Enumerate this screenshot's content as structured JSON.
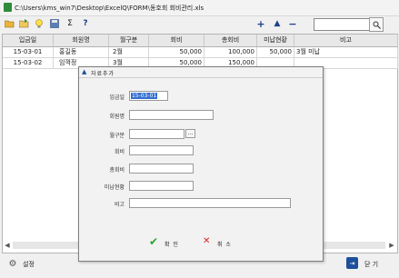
{
  "window": {
    "title": "C:\\Users\\kms_win7\\Desktop\\ExcelQ\\FORM\\동호회 회비관리.xls"
  },
  "toolbar": {
    "add_symbol": "+",
    "up_symbol": "▲",
    "remove_symbol": "−",
    "sum_symbol": "Σ",
    "help_symbol": "?",
    "search_value": ""
  },
  "grid": {
    "columns": [
      "입금일",
      "회원명",
      "월구분",
      "회비",
      "총회비",
      "미납현황",
      "비고"
    ],
    "rows": [
      [
        "15-03-01",
        "홍길동",
        "2월",
        "50,000",
        "100,000",
        "50,000",
        "3월 미납"
      ],
      [
        "15-03-02",
        "임꺽정",
        "3월",
        "50,000",
        "150,000",
        "",
        ""
      ]
    ]
  },
  "dialog": {
    "title": "자료추가",
    "labels": {
      "date": "입금일",
      "member": "회원명",
      "month": "월구분",
      "fee": "회비",
      "total": "총회비",
      "unpaid": "미납현황",
      "note": "비고"
    },
    "values": {
      "date": "15-03-01",
      "member": "",
      "month": "",
      "fee": "",
      "total": "",
      "unpaid": "",
      "note": ""
    },
    "browse_label": "...",
    "confirm_label": "확 인",
    "cancel_label": "취 소"
  },
  "footer": {
    "settings_label": "설정",
    "close_label": "닫 기"
  }
}
